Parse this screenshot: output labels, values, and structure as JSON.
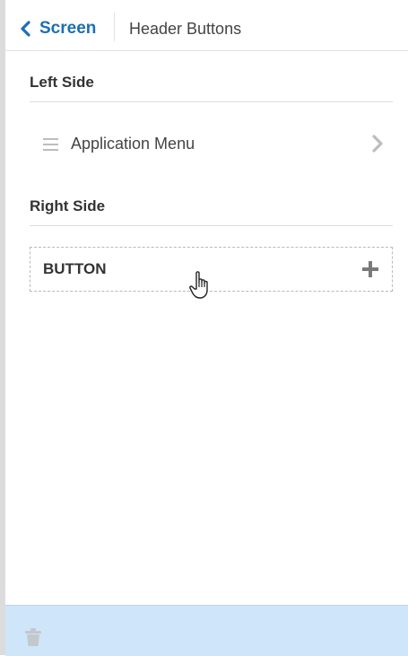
{
  "header": {
    "back_label": "Screen",
    "title": "Header Buttons"
  },
  "left_side": {
    "title": "Left Side",
    "items": [
      {
        "label": "Application Menu"
      }
    ]
  },
  "right_side": {
    "title": "Right Side",
    "button_slot_label": "BUTTON"
  },
  "icons": {
    "back": "chevron-left-icon",
    "drag": "drag-handle-icon",
    "navigate": "chevron-right-icon",
    "add": "plus-icon",
    "delete": "trash-icon",
    "cursor": "hand-pointer-icon"
  },
  "colors": {
    "accent": "#1c6fb5",
    "footer_bg": "#cfe5f9",
    "icon_gray": "#bdbdbd"
  }
}
